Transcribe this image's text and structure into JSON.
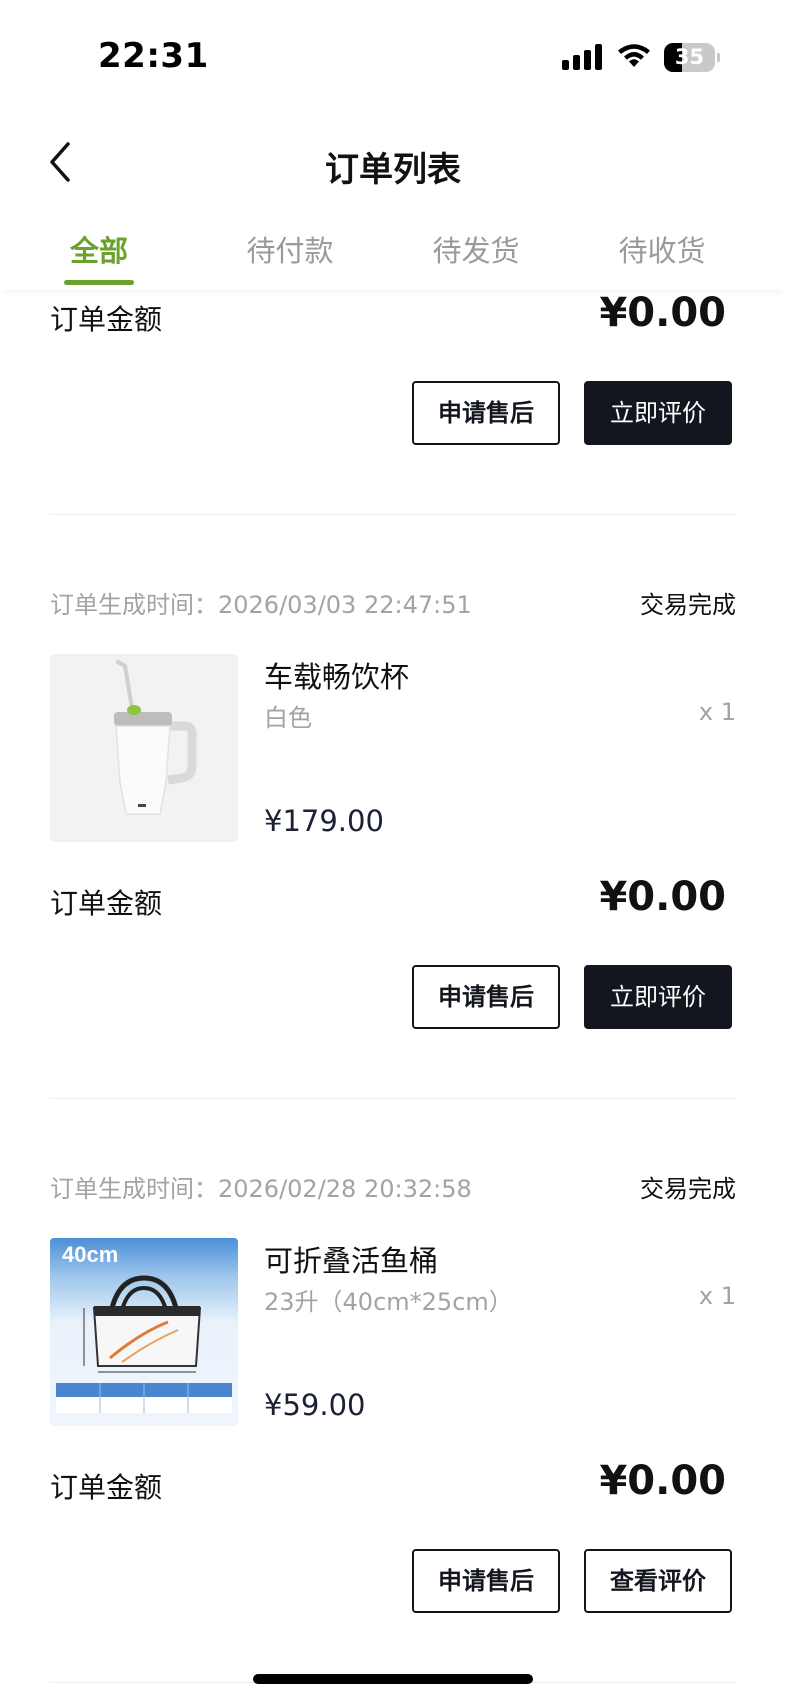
{
  "status_bar": {
    "time": "22:31",
    "battery_level": "35"
  },
  "nav": {
    "title": "订单列表"
  },
  "tabs": [
    {
      "label": "全部",
      "active": true
    },
    {
      "label": "待付款",
      "active": false
    },
    {
      "label": "待发货",
      "active": false
    },
    {
      "label": "待收货",
      "active": false
    }
  ],
  "orders": [
    {
      "amount_label": "订单金额",
      "amount": "¥0.00",
      "actions": [
        "申请售后",
        "立即评价"
      ]
    },
    {
      "time_label": "订单生成时间：",
      "time": "2026/03/03 22:47:51",
      "status": "交易完成",
      "product": {
        "name": "车载畅饮杯",
        "spec": "白色",
        "qty": "x 1",
        "price": "¥179.00"
      },
      "amount_label": "订单金额",
      "amount": "¥0.00",
      "actions": [
        "申请售后",
        "立即评价"
      ]
    },
    {
      "time_label": "订单生成时间：",
      "time": "2026/02/28 20:32:58",
      "status": "交易完成",
      "product": {
        "name": "可折叠活鱼桶",
        "spec": "23升（40cm*25cm）",
        "qty": "x 1",
        "price": "¥59.00",
        "image_badge": "40cm"
      },
      "amount_label": "订单金额",
      "amount": "¥0.00",
      "actions": [
        "申请售后",
        "查看评价"
      ]
    }
  ],
  "colors": {
    "accent": "#6aa22c",
    "dark_button": "#14161f",
    "muted_text": "#a3a3a3"
  },
  "icons": [
    "signal-icon",
    "wifi-icon",
    "battery-icon",
    "back-arrow-icon"
  ]
}
